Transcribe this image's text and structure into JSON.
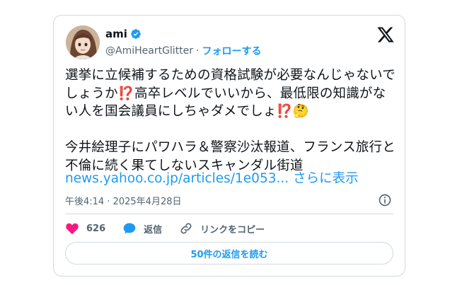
{
  "author": {
    "name": "ami",
    "handle": "@AmiHeartGlitter",
    "separator": "·",
    "follow_label": "フォローする"
  },
  "tweet": {
    "paragraph1": "選挙に立候補するための資格試験が必要なんじゃないでしょうか⁉️高卒レベルでいいから、最低限の知識がない人を国会議員にしちゃダメでしょ⁉️🤔",
    "paragraph2": "今井絵理子にパワハラ＆警察沙汰報道、フランス旅行と不倫に続く果てしないスキャンダル街道",
    "link_text": "news.yahoo.co.jp/articles/1e053...",
    "more_label": "さらに表示",
    "timestamp": "午後4:14 · 2025年4月28日"
  },
  "actions": {
    "like_count": "626",
    "reply_label": "返信",
    "copy_link_label": "リンクをコピー"
  },
  "read_replies_label": "50件の返信を読む",
  "colors": {
    "accent": "#1d9bf0",
    "like": "#f91880",
    "muted": "#536471",
    "border": "#cfd9de"
  }
}
